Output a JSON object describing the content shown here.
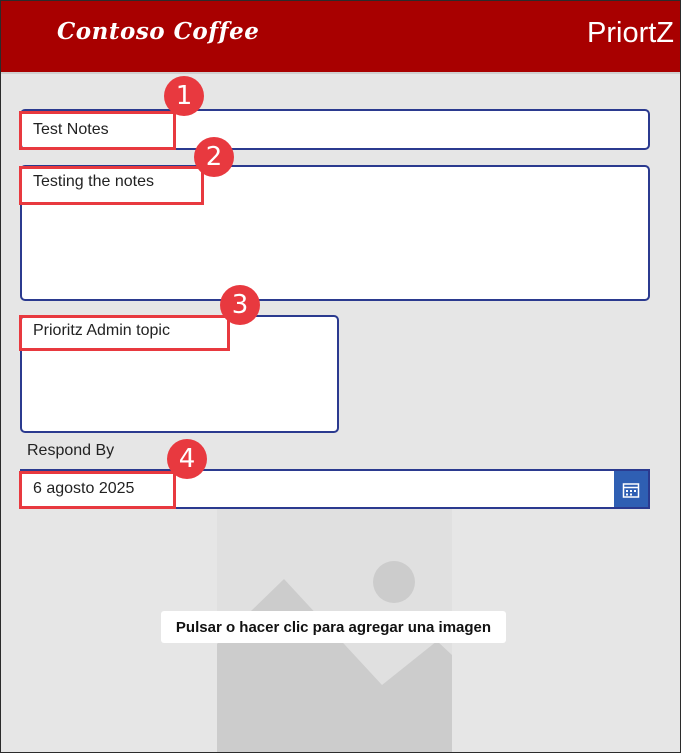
{
  "header": {
    "logo_text": "Contoso Coffee",
    "screen_title": "PriortZ",
    "background_color": "#a80000"
  },
  "form": {
    "title_field": {
      "value": "Test Notes"
    },
    "notes_field": {
      "value": "Testing the notes"
    },
    "topic_field": {
      "value": "Prioritz Admin topic"
    },
    "respond_by": {
      "label": "Respond By",
      "value": "6 agosto 2025",
      "calendar_icon": "calendar-icon"
    },
    "image_picker": {
      "hint": "Pulsar o hacer clic para agregar una imagen",
      "icon": "image-placeholder-icon"
    }
  },
  "annotations": {
    "badges": [
      "1",
      "2",
      "3",
      "4"
    ],
    "color": "#e8393f"
  }
}
